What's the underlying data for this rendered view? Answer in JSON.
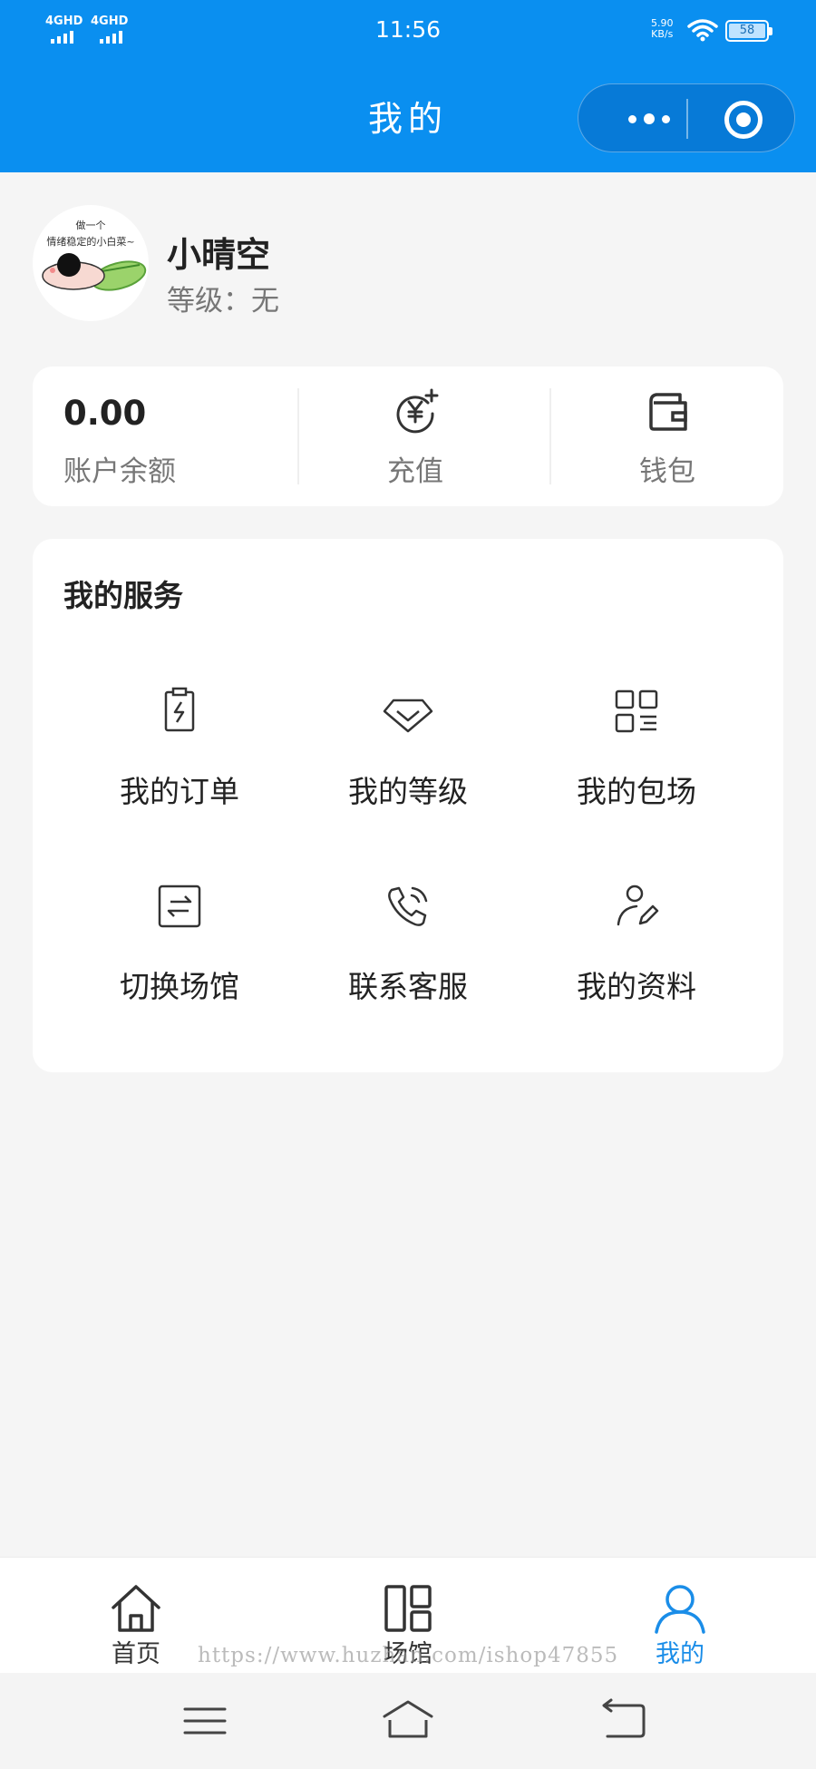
{
  "status_bar": {
    "signal_1": "4GHD",
    "signal_2": "4GHD",
    "time": "11:56",
    "net_speed_value": "5.90",
    "net_speed_unit": "KB/s",
    "battery": "58"
  },
  "header": {
    "title": "我的",
    "menu_icon": "more-dots-icon",
    "close_icon": "target-icon",
    "background_color": "#0a8ff0"
  },
  "profile": {
    "avatar_text_line1": "做一个",
    "avatar_text_line2": "情绪稳定的小白菜~",
    "username": "小晴空",
    "level_label": "等级：",
    "level_value": "无"
  },
  "balance": {
    "amount": "0.00",
    "amount_label": "账户余额",
    "recharge_label": "充值",
    "recharge_icon": "yuan-plus-icon",
    "wallet_label": "钱包",
    "wallet_icon": "wallet-icon"
  },
  "services": {
    "title": "我的服务",
    "items": [
      {
        "label": "我的订单",
        "icon": "order-clipboard-icon"
      },
      {
        "label": "我的等级",
        "icon": "diamond-icon"
      },
      {
        "label": "我的包场",
        "icon": "grid-list-icon"
      },
      {
        "label": "切换场馆",
        "icon": "switch-arrows-icon"
      },
      {
        "label": "联系客服",
        "icon": "phone-call-icon"
      },
      {
        "label": "我的资料",
        "icon": "user-edit-icon"
      }
    ]
  },
  "tabbar": {
    "items": [
      {
        "label": "首页",
        "icon": "home-icon",
        "active": false
      },
      {
        "label": "场馆",
        "icon": "venue-layout-icon",
        "active": false
      },
      {
        "label": "我的",
        "icon": "user-icon",
        "active": true
      }
    ],
    "active_color": "#1a8de8"
  },
  "watermark": "https://www.huzhan.com/ishop47855",
  "system_nav": {
    "menu_icon": "menu-icon",
    "home_icon": "home-outline-icon",
    "back_icon": "back-icon"
  }
}
